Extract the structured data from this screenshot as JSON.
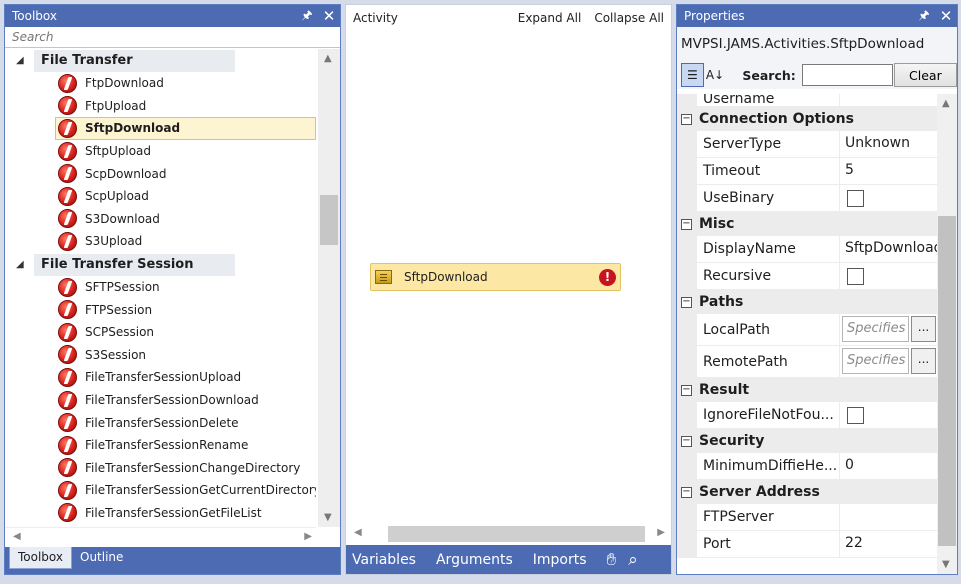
{
  "toolbox": {
    "title": "Toolbox",
    "search_placeholder": "Search",
    "groups": [
      {
        "label": "File Transfer",
        "items": [
          "FtpDownload",
          "FtpUpload",
          "SftpDownload",
          "SftpUpload",
          "ScpDownload",
          "ScpUpload",
          "S3Download",
          "S3Upload"
        ]
      },
      {
        "label": "File Transfer Session",
        "items": [
          "SFTPSession",
          "FTPSession",
          "SCPSession",
          "S3Session",
          "FileTransferSessionUpload",
          "FileTransferSessionDownload",
          "FileTransferSessionDelete",
          "FileTransferSessionRename",
          "FileTransferSessionChangeDirectory",
          "FileTransferSessionGetCurrentDirectory",
          "FileTransferSessionGetFileList"
        ]
      }
    ],
    "selected_item": "SftpDownload",
    "tabs": [
      "Toolbox",
      "Outline"
    ]
  },
  "designer": {
    "header_label": "Activity",
    "expand_all": "Expand All",
    "collapse_all": "Collapse All",
    "activity_label": "SftpDownload",
    "footer_tabs": [
      "Variables",
      "Arguments",
      "Imports"
    ]
  },
  "properties": {
    "title": "Properties",
    "type_name": "MVPSI.JAMS.Activities.SftpDownload",
    "search_label": "Search:",
    "search_value": "",
    "clear_label": "Clear",
    "partial_row": {
      "name": "Username",
      "value": ""
    },
    "categories": [
      {
        "label": "Connection Options",
        "rows": [
          {
            "name": "ServerType",
            "value": "Unknown",
            "kind": "text"
          },
          {
            "name": "Timeout",
            "value": "5",
            "kind": "text"
          },
          {
            "name": "UseBinary",
            "value": "",
            "kind": "checkbox"
          }
        ]
      },
      {
        "label": "Misc",
        "rows": [
          {
            "name": "DisplayName",
            "value": "SftpDownload",
            "kind": "text"
          },
          {
            "name": "Recursive",
            "value": "",
            "kind": "checkbox"
          }
        ]
      },
      {
        "label": "Paths",
        "rows": [
          {
            "name": "LocalPath",
            "value": "Specifies",
            "kind": "expr"
          },
          {
            "name": "RemotePath",
            "value": "Specifies",
            "kind": "expr"
          }
        ]
      },
      {
        "label": "Result",
        "rows": [
          {
            "name": "IgnoreFileNotFou...",
            "value": "",
            "kind": "checkbox"
          }
        ]
      },
      {
        "label": "Security",
        "rows": [
          {
            "name": "MinimumDiffieHe...",
            "value": "0",
            "kind": "text"
          }
        ]
      },
      {
        "label": "Server Address",
        "rows": [
          {
            "name": "FTPServer",
            "value": "",
            "kind": "text"
          },
          {
            "name": "Port",
            "value": "22",
            "kind": "text"
          }
        ]
      }
    ]
  }
}
